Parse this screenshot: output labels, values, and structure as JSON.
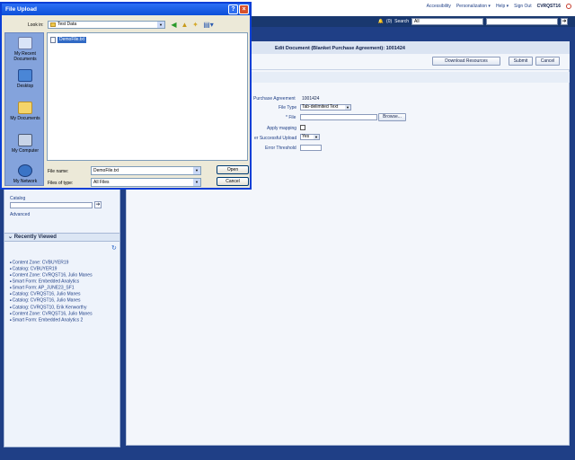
{
  "header": {
    "links": [
      "Accessibility",
      "Personalization ▾",
      "Help ▾",
      "Sign Out"
    ],
    "user": "CVRQST16",
    "notifications": "(0)",
    "search_label": "Search",
    "search_scope": "All"
  },
  "page": {
    "title": "Edit Document (Blanket Purchase Agreement): 1001424",
    "buttons": {
      "download": "Download Resources",
      "submit": "Submit",
      "cancel": "Cancel"
    }
  },
  "form": {
    "pa_label": "Purchase Agreement",
    "pa_value": "1001424",
    "file_type_label": "File Type",
    "file_type_value": "Tab-delimited Text",
    "file_label": "* File",
    "browse": "Browse...",
    "apply_mapping_label": "Apply mapping",
    "after_upload_label": "er Successful Upload",
    "after_upload_value": "Yes",
    "error_threshold_label": "Error Threshold"
  },
  "sidebar": {
    "catalog_label": "Catalog",
    "advanced_link": "Advanced",
    "recently_viewed_title": "Recently Viewed",
    "recent_items": [
      "Content Zone: CVBUYER19",
      "Catalog: CVBUYER19",
      "Content Zone: CVRQST16, Julio Manes",
      "Smart Form: Embedded Analytics",
      "Smart Form: AP_JUNE23_SF1",
      "Catalog: CVRQST16, Julio Manes",
      "Catalog: CVRQST16, Julio Manes",
      "Catalog: CVRQST10, Erik Kenworthy",
      "Content Zone: CVRQST16, Julio Manes",
      "Smart Form: Embedded Analytics 2"
    ]
  },
  "dialog": {
    "title": "File Upload",
    "look_in_label": "Look in:",
    "look_in_value": "Test Data",
    "places": [
      "My Recent Documents",
      "Desktop",
      "My Documents",
      "My Computer",
      "My Network"
    ],
    "files": [
      "DemoFile.txt"
    ],
    "file_name_label": "File name:",
    "file_name_value": "DemoFile.txt",
    "files_of_type_label": "Files of type:",
    "files_of_type_value": "All Files",
    "open_label": "Open",
    "cancel_label": "Cancel"
  }
}
